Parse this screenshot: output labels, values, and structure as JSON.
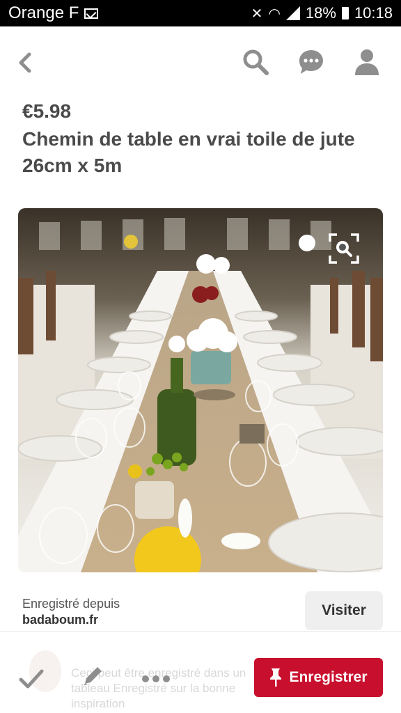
{
  "status_bar": {
    "carrier": "Orange F",
    "battery": "18%",
    "time": "10:18",
    "icons": [
      "mail-icon",
      "mute-icon",
      "wifi-icon",
      "signal-icon",
      "battery-icon"
    ]
  },
  "header": {
    "icons": [
      "back-icon",
      "search-icon",
      "chat-icon",
      "profile-icon"
    ]
  },
  "product": {
    "price": "€5.98",
    "title": "Chemin de table en vrai toile de jute 26cm x 5m"
  },
  "source": {
    "label": "Enregistré depuis",
    "domain": "badaboum.fr",
    "visit_label": "Visiter"
  },
  "actions": {
    "save_label": "Enregistrer",
    "ghost_text": "Ceci peut être enregistré dans un tableau Enregistré sur la bonne inspiration"
  },
  "colors": {
    "accent": "#c8102e",
    "text": "#4a4a4a",
    "icon_gray": "#8e8e8e"
  }
}
